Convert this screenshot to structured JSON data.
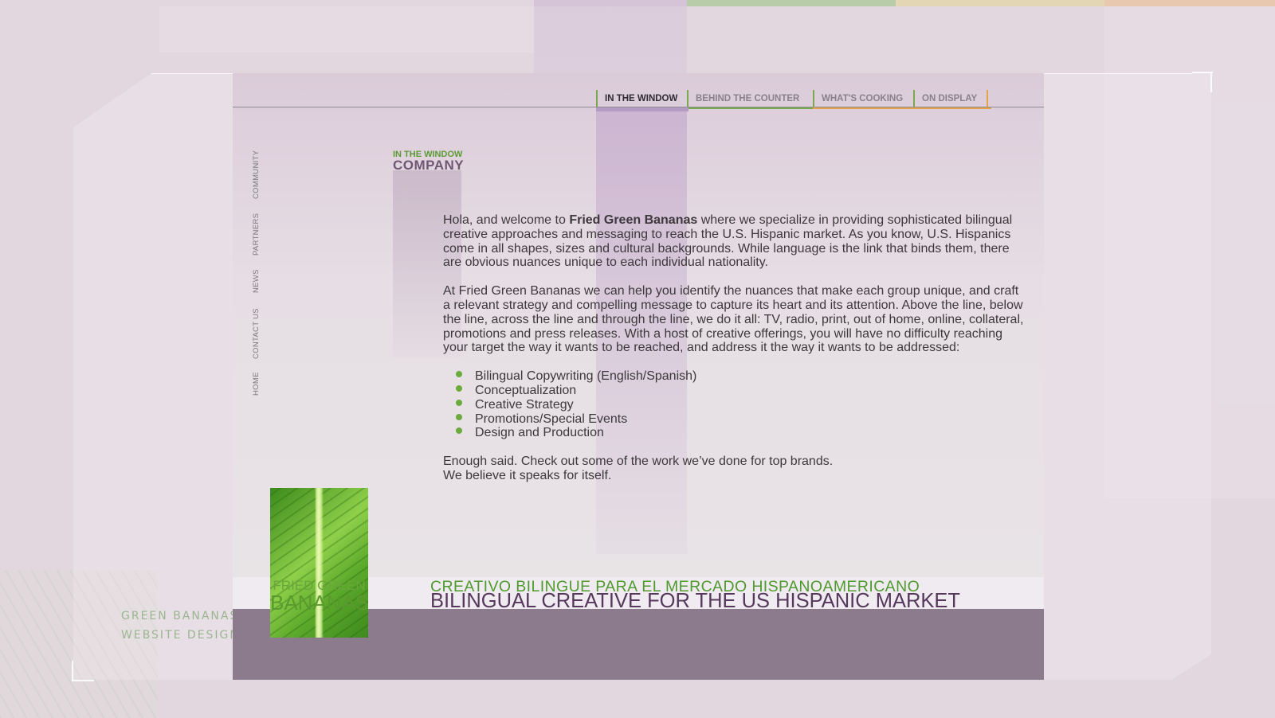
{
  "nav": {
    "tabs": [
      {
        "label": "IN THE WINDOW"
      },
      {
        "label": "BEHIND THE COUNTER"
      },
      {
        "label": "WHAT'S COOKING"
      },
      {
        "label": "ON DISPLAY"
      }
    ]
  },
  "sidebar": {
    "links": [
      "COMMUNITY",
      "PARTNERS",
      "NEWS",
      "CONTACT US",
      "HOME"
    ]
  },
  "section": {
    "kicker": "IN THE WINDOW",
    "title": "COMPANY"
  },
  "content": {
    "intro_before": "Hola, and welcome to ",
    "brand": "Fried Green Bananas",
    "intro_after": " where we specialize in providing sophisticated bilingual creative approaches and messaging to reach the U.S. Hispanic market. As you know, U.S. Hispanics come in all shapes, sizes and cultural backgrounds. While language is the link that binds them, there are obvious nuances unique to each individual nationality.",
    "paragraph2": "At Fried Green Bananas we can help you identify the nuances that make each group unique, and craft a relevant strategy and compelling message to capture its heart and its attention. Above the line, below the line, across the line and through the line, we do it all:  TV, radio, print, out of home, online, collateral, promotions and press releases.  With a host of creative offerings, you will have no difficulty reaching your target the way it wants to be reached, and address it the way it wants to be addressed:",
    "services": [
      "Bilingual Copywriting (English/Spanish)",
      "Conceptualization",
      "Creative Strategy",
      "Promotions/Special Events",
      "Design and Production"
    ],
    "closing_line1": "Enough said. Check out some of the work we’ve done for top brands.",
    "closing_line2": "We believe it speaks for itself."
  },
  "logo": {
    "line1": "FRIED GREEN",
    "line2": "BANANAS"
  },
  "tagline": {
    "spanish": "CREATIVO BILINGUE PARA EL MERCADO HISPANOAMERICANO",
    "english": "BILINGUAL CREATIVE FOR THE US HISPANIC MARKET"
  },
  "caption": {
    "line1": "GREEN BANANAS",
    "line2": "WEBSITE DESIGN"
  },
  "colors": {
    "accent_green": "#6aaa3e",
    "brand_purple": "#57385d",
    "footer_purple": "#8c7a8d",
    "tab_orange": "#e6a44a"
  }
}
